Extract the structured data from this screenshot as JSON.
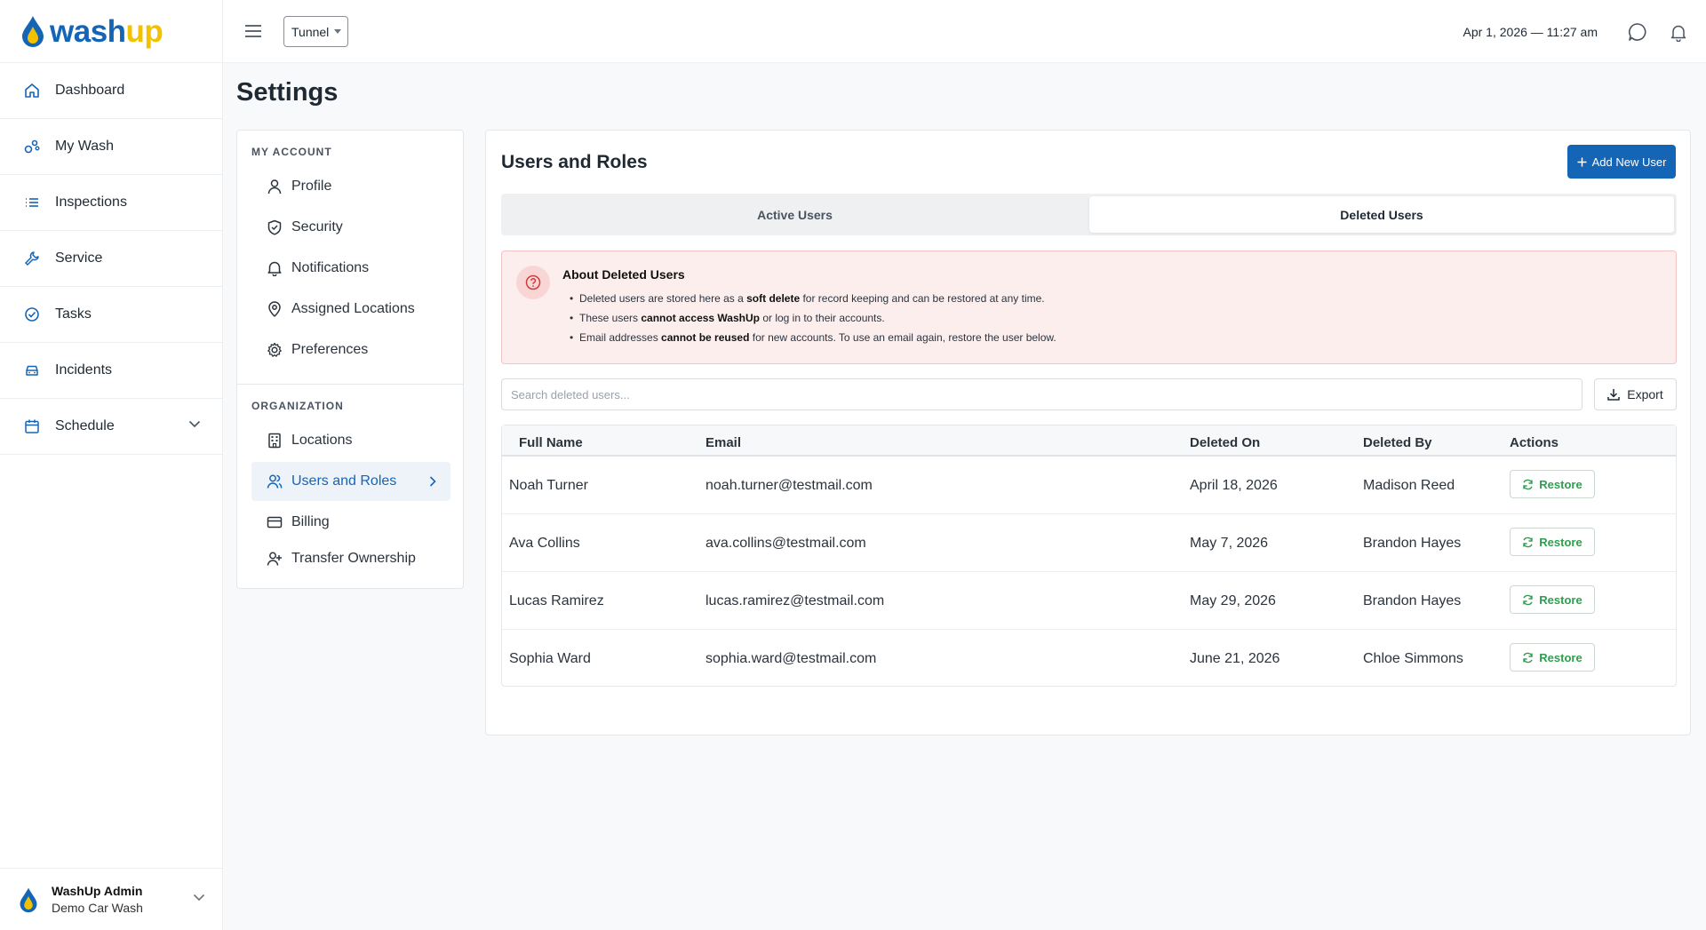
{
  "app": {
    "logo_wash": "wash",
    "logo_up": "up"
  },
  "topbar": {
    "location_select": "Tunnel",
    "datetime": "Apr 1, 2026 — 11:27 am"
  },
  "sidebar": {
    "items": [
      {
        "label": "Dashboard",
        "icon": "home-icon"
      },
      {
        "label": "My Wash",
        "icon": "wash-icon"
      },
      {
        "label": "Inspections",
        "icon": "list-icon"
      },
      {
        "label": "Service",
        "icon": "wrench-icon"
      },
      {
        "label": "Tasks",
        "icon": "check-circle-icon"
      },
      {
        "label": "Incidents",
        "icon": "car-icon"
      },
      {
        "label": "Schedule",
        "icon": "calendar-icon"
      }
    ],
    "user": {
      "name": "WashUp Admin",
      "org": "Demo Car Wash"
    }
  },
  "page": {
    "title": "Settings"
  },
  "settings_menu": {
    "my_account_label": "MY ACCOUNT",
    "my_account": [
      "Profile",
      "Security",
      "Notifications",
      "Assigned Locations",
      "Preferences"
    ],
    "organization_label": "ORGANIZATION",
    "organization": [
      "Locations",
      "Users and Roles",
      "Billing",
      "Transfer Ownership"
    ],
    "active_item": "Users and Roles"
  },
  "users": {
    "title": "Users and Roles",
    "add_button": "Add New User",
    "tabs": [
      "Active Users",
      "Deleted Users"
    ],
    "active_tab": "Deleted Users",
    "info": {
      "title": "About Deleted Users",
      "lines": [
        {
          "pre": "Deleted users are stored here as a ",
          "bold": "soft delete",
          "post": " for record keeping and can be restored at any time."
        },
        {
          "pre": "These users ",
          "bold": "cannot access WashUp",
          "post": " or log in to their accounts."
        },
        {
          "pre": "Email addresses ",
          "bold": "cannot be reused",
          "post": " for new accounts. To use an email again, restore the user below."
        }
      ]
    },
    "search_placeholder": "Search deleted users...",
    "export_label": "Export",
    "columns": [
      "Full Name",
      "Email",
      "Deleted On",
      "Deleted By",
      "Actions"
    ],
    "rows": [
      {
        "name": "Noah Turner",
        "email": "noah.turner@testmail.com",
        "deleted_on": "April 18, 2026",
        "deleted_by": "Madison Reed",
        "action": "Restore"
      },
      {
        "name": "Ava Collins",
        "email": "ava.collins@testmail.com",
        "deleted_on": "May 7, 2026",
        "deleted_by": "Brandon Hayes",
        "action": "Restore"
      },
      {
        "name": "Lucas Ramirez",
        "email": "lucas.ramirez@testmail.com",
        "deleted_on": "May 29, 2026",
        "deleted_by": "Brandon Hayes",
        "action": "Restore"
      },
      {
        "name": "Sophia Ward",
        "email": "sophia.ward@testmail.com",
        "deleted_on": "June 21, 2026",
        "deleted_by": "Chloe Simmons",
        "action": "Restore"
      }
    ]
  },
  "colors": {
    "brand_blue": "#1565b7",
    "brand_yellow": "#f2c200",
    "restore_green": "#2e9e4f",
    "info_bg": "#fdeeee"
  }
}
